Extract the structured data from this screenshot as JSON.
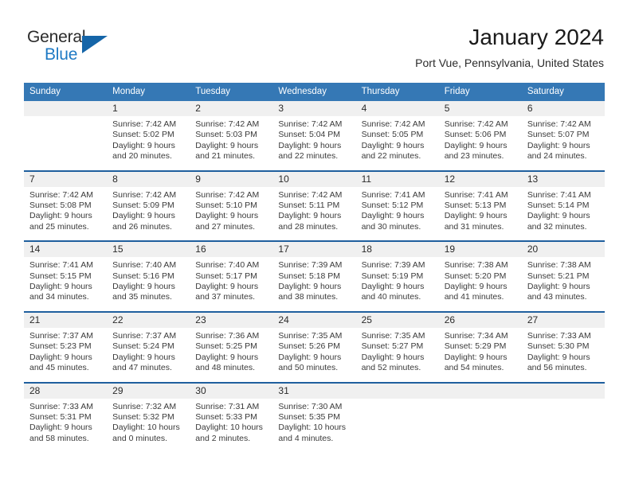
{
  "brand": {
    "name_part1": "General",
    "name_part2": "Blue",
    "logo_icon": "triangle-logo-icon"
  },
  "header": {
    "month_title": "January 2024",
    "location": "Port Vue, Pennsylvania, United States"
  },
  "colors": {
    "header_blue": "#3578b5",
    "separator_blue": "#1f5f9e",
    "number_band": "#f0f0f0",
    "brand_blue": "#1f7ac4",
    "logo_blue": "#1565a8"
  },
  "weekday_headers": [
    "Sunday",
    "Monday",
    "Tuesday",
    "Wednesday",
    "Thursday",
    "Friday",
    "Saturday"
  ],
  "weeks": [
    {
      "days": [
        {
          "number": "",
          "sunrise": "",
          "sunset": "",
          "daylight1": "",
          "daylight2": "",
          "empty": true
        },
        {
          "number": "1",
          "sunrise": "Sunrise: 7:42 AM",
          "sunset": "Sunset: 5:02 PM",
          "daylight1": "Daylight: 9 hours",
          "daylight2": "and 20 minutes.",
          "empty": false
        },
        {
          "number": "2",
          "sunrise": "Sunrise: 7:42 AM",
          "sunset": "Sunset: 5:03 PM",
          "daylight1": "Daylight: 9 hours",
          "daylight2": "and 21 minutes.",
          "empty": false
        },
        {
          "number": "3",
          "sunrise": "Sunrise: 7:42 AM",
          "sunset": "Sunset: 5:04 PM",
          "daylight1": "Daylight: 9 hours",
          "daylight2": "and 22 minutes.",
          "empty": false
        },
        {
          "number": "4",
          "sunrise": "Sunrise: 7:42 AM",
          "sunset": "Sunset: 5:05 PM",
          "daylight1": "Daylight: 9 hours",
          "daylight2": "and 22 minutes.",
          "empty": false
        },
        {
          "number": "5",
          "sunrise": "Sunrise: 7:42 AM",
          "sunset": "Sunset: 5:06 PM",
          "daylight1": "Daylight: 9 hours",
          "daylight2": "and 23 minutes.",
          "empty": false
        },
        {
          "number": "6",
          "sunrise": "Sunrise: 7:42 AM",
          "sunset": "Sunset: 5:07 PM",
          "daylight1": "Daylight: 9 hours",
          "daylight2": "and 24 minutes.",
          "empty": false
        }
      ]
    },
    {
      "days": [
        {
          "number": "7",
          "sunrise": "Sunrise: 7:42 AM",
          "sunset": "Sunset: 5:08 PM",
          "daylight1": "Daylight: 9 hours",
          "daylight2": "and 25 minutes.",
          "empty": false
        },
        {
          "number": "8",
          "sunrise": "Sunrise: 7:42 AM",
          "sunset": "Sunset: 5:09 PM",
          "daylight1": "Daylight: 9 hours",
          "daylight2": "and 26 minutes.",
          "empty": false
        },
        {
          "number": "9",
          "sunrise": "Sunrise: 7:42 AM",
          "sunset": "Sunset: 5:10 PM",
          "daylight1": "Daylight: 9 hours",
          "daylight2": "and 27 minutes.",
          "empty": false
        },
        {
          "number": "10",
          "sunrise": "Sunrise: 7:42 AM",
          "sunset": "Sunset: 5:11 PM",
          "daylight1": "Daylight: 9 hours",
          "daylight2": "and 28 minutes.",
          "empty": false
        },
        {
          "number": "11",
          "sunrise": "Sunrise: 7:41 AM",
          "sunset": "Sunset: 5:12 PM",
          "daylight1": "Daylight: 9 hours",
          "daylight2": "and 30 minutes.",
          "empty": false
        },
        {
          "number": "12",
          "sunrise": "Sunrise: 7:41 AM",
          "sunset": "Sunset: 5:13 PM",
          "daylight1": "Daylight: 9 hours",
          "daylight2": "and 31 minutes.",
          "empty": false
        },
        {
          "number": "13",
          "sunrise": "Sunrise: 7:41 AM",
          "sunset": "Sunset: 5:14 PM",
          "daylight1": "Daylight: 9 hours",
          "daylight2": "and 32 minutes.",
          "empty": false
        }
      ]
    },
    {
      "days": [
        {
          "number": "14",
          "sunrise": "Sunrise: 7:41 AM",
          "sunset": "Sunset: 5:15 PM",
          "daylight1": "Daylight: 9 hours",
          "daylight2": "and 34 minutes.",
          "empty": false
        },
        {
          "number": "15",
          "sunrise": "Sunrise: 7:40 AM",
          "sunset": "Sunset: 5:16 PM",
          "daylight1": "Daylight: 9 hours",
          "daylight2": "and 35 minutes.",
          "empty": false
        },
        {
          "number": "16",
          "sunrise": "Sunrise: 7:40 AM",
          "sunset": "Sunset: 5:17 PM",
          "daylight1": "Daylight: 9 hours",
          "daylight2": "and 37 minutes.",
          "empty": false
        },
        {
          "number": "17",
          "sunrise": "Sunrise: 7:39 AM",
          "sunset": "Sunset: 5:18 PM",
          "daylight1": "Daylight: 9 hours",
          "daylight2": "and 38 minutes.",
          "empty": false
        },
        {
          "number": "18",
          "sunrise": "Sunrise: 7:39 AM",
          "sunset": "Sunset: 5:19 PM",
          "daylight1": "Daylight: 9 hours",
          "daylight2": "and 40 minutes.",
          "empty": false
        },
        {
          "number": "19",
          "sunrise": "Sunrise: 7:38 AM",
          "sunset": "Sunset: 5:20 PM",
          "daylight1": "Daylight: 9 hours",
          "daylight2": "and 41 minutes.",
          "empty": false
        },
        {
          "number": "20",
          "sunrise": "Sunrise: 7:38 AM",
          "sunset": "Sunset: 5:21 PM",
          "daylight1": "Daylight: 9 hours",
          "daylight2": "and 43 minutes.",
          "empty": false
        }
      ]
    },
    {
      "days": [
        {
          "number": "21",
          "sunrise": "Sunrise: 7:37 AM",
          "sunset": "Sunset: 5:23 PM",
          "daylight1": "Daylight: 9 hours",
          "daylight2": "and 45 minutes.",
          "empty": false
        },
        {
          "number": "22",
          "sunrise": "Sunrise: 7:37 AM",
          "sunset": "Sunset: 5:24 PM",
          "daylight1": "Daylight: 9 hours",
          "daylight2": "and 47 minutes.",
          "empty": false
        },
        {
          "number": "23",
          "sunrise": "Sunrise: 7:36 AM",
          "sunset": "Sunset: 5:25 PM",
          "daylight1": "Daylight: 9 hours",
          "daylight2": "and 48 minutes.",
          "empty": false
        },
        {
          "number": "24",
          "sunrise": "Sunrise: 7:35 AM",
          "sunset": "Sunset: 5:26 PM",
          "daylight1": "Daylight: 9 hours",
          "daylight2": "and 50 minutes.",
          "empty": false
        },
        {
          "number": "25",
          "sunrise": "Sunrise: 7:35 AM",
          "sunset": "Sunset: 5:27 PM",
          "daylight1": "Daylight: 9 hours",
          "daylight2": "and 52 minutes.",
          "empty": false
        },
        {
          "number": "26",
          "sunrise": "Sunrise: 7:34 AM",
          "sunset": "Sunset: 5:29 PM",
          "daylight1": "Daylight: 9 hours",
          "daylight2": "and 54 minutes.",
          "empty": false
        },
        {
          "number": "27",
          "sunrise": "Sunrise: 7:33 AM",
          "sunset": "Sunset: 5:30 PM",
          "daylight1": "Daylight: 9 hours",
          "daylight2": "and 56 minutes.",
          "empty": false
        }
      ]
    },
    {
      "days": [
        {
          "number": "28",
          "sunrise": "Sunrise: 7:33 AM",
          "sunset": "Sunset: 5:31 PM",
          "daylight1": "Daylight: 9 hours",
          "daylight2": "and 58 minutes.",
          "empty": false
        },
        {
          "number": "29",
          "sunrise": "Sunrise: 7:32 AM",
          "sunset": "Sunset: 5:32 PM",
          "daylight1": "Daylight: 10 hours",
          "daylight2": "and 0 minutes.",
          "empty": false
        },
        {
          "number": "30",
          "sunrise": "Sunrise: 7:31 AM",
          "sunset": "Sunset: 5:33 PM",
          "daylight1": "Daylight: 10 hours",
          "daylight2": "and 2 minutes.",
          "empty": false
        },
        {
          "number": "31",
          "sunrise": "Sunrise: 7:30 AM",
          "sunset": "Sunset: 5:35 PM",
          "daylight1": "Daylight: 10 hours",
          "daylight2": "and 4 minutes.",
          "empty": false
        },
        {
          "number": "",
          "sunrise": "",
          "sunset": "",
          "daylight1": "",
          "daylight2": "",
          "empty": true
        },
        {
          "number": "",
          "sunrise": "",
          "sunset": "",
          "daylight1": "",
          "daylight2": "",
          "empty": true
        },
        {
          "number": "",
          "sunrise": "",
          "sunset": "",
          "daylight1": "",
          "daylight2": "",
          "empty": true
        }
      ]
    }
  ]
}
